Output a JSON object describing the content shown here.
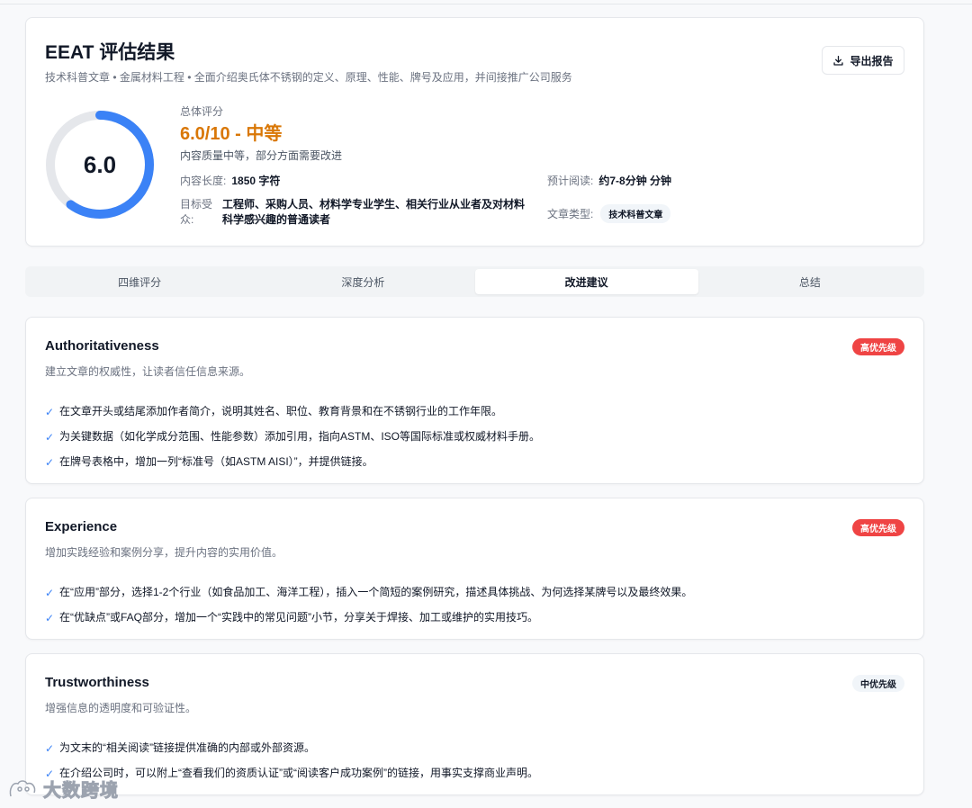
{
  "header": {
    "title": "EEAT 评估结果",
    "subtitle": "技术科普文章 • 金属材料工程 • 全面介绍奥氏体不锈钢的定义、原理、性能、牌号及应用，并间接推广公司服务",
    "export_label": "导出报告"
  },
  "score": {
    "value": "6.0",
    "fraction": 0.6,
    "label": "总体评分",
    "main": "6.0/10 - 中等",
    "desc": "内容质量中等，部分方面需要改进",
    "ring_color": "#3b82f6",
    "main_color": "#d97706"
  },
  "meta": {
    "length_label": "内容长度:",
    "length_value": "1850 字符",
    "read_label": "预计阅读:",
    "read_value": "约7-8分钟 分钟",
    "audience_label": "目标受众:",
    "audience_value": "工程师、采购人员、材料学专业学生、相关行业从业者及对材料科学感兴趣的普通读者",
    "type_label": "文章类型:",
    "type_value": "技术科普文章"
  },
  "tabs": [
    {
      "label": "四维评分"
    },
    {
      "label": "深度分析"
    },
    {
      "label": "改进建议",
      "active": true
    },
    {
      "label": "总结"
    }
  ],
  "suggestions": [
    {
      "title": "Authoritativeness",
      "desc": "建立文章的权威性，让读者信任信息来源。",
      "priority": "高优先级",
      "items": [
        "在文章开头或结尾添加作者简介，说明其姓名、职位、教育背景和在不锈钢行业的工作年限。",
        "为关键数据（如化学成分范围、性能参数）添加引用，指向ASTM、ISO等国际标准或权威材料手册。",
        "在牌号表格中，增加一列“标准号（如ASTM AISI）”，并提供链接。"
      ]
    },
    {
      "title": "Experience",
      "desc": "增加实践经验和案例分享，提升内容的实用价值。",
      "priority": "高优先级",
      "items": [
        "在“应用”部分，选择1-2个行业（如食品加工、海洋工程），插入一个简短的案例研究，描述具体挑战、为何选择某牌号以及最终效果。",
        "在“优缺点”或FAQ部分，增加一个“实践中的常见问题”小节，分享关于焊接、加工或维护的实用技巧。"
      ]
    },
    {
      "title": "Trustworthiness",
      "desc": "增强信息的透明度和可验证性。",
      "priority": "中优先级",
      "items": [
        "为文末的“相关阅读”链接提供准确的内部或外部资源。",
        "在介绍公司时，可以附上“查看我们的资质认证”或“阅读客户成功案例”的链接，用事实支撑商业声明。"
      ]
    }
  ],
  "watermark": "大数跨境",
  "check_glyph": "✓"
}
